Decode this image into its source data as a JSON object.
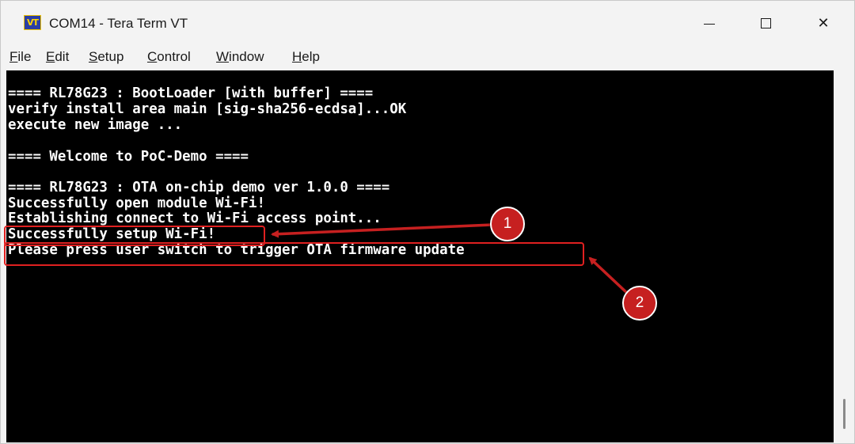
{
  "window": {
    "title": "COM14 - Tera Term VT",
    "icon_text": "VT",
    "controls": {
      "minimize": "minimize-icon",
      "maximize": "maximize-icon",
      "close": "close-icon",
      "close_glyph": "✕"
    }
  },
  "menu": {
    "items": [
      {
        "mnemonic": "F",
        "rest": "ile"
      },
      {
        "mnemonic": "E",
        "rest": "dit"
      },
      {
        "mnemonic": "S",
        "rest": "etup"
      },
      {
        "mnemonic": "C",
        "rest": "ontrol"
      },
      {
        "mnemonic": "W",
        "rest": "indow"
      },
      {
        "mnemonic": "H",
        "rest": "elp"
      }
    ]
  },
  "terminal": {
    "lines": [
      "==== RL78G23 : BootLoader [with buffer] ====",
      "verify install area main [sig-sha256-ecdsa]...OK",
      "execute new image ...",
      "",
      "==== Welcome to PoC-Demo ====",
      "",
      "==== RL78G23 : OTA on-chip demo ver 1.0.0 ====",
      "Successfully open module Wi-Fi!",
      "Establishing connect to Wi-Fi access point...",
      "Successfully setup Wi-Fi!",
      "Please press user switch to trigger OTA firmware update"
    ]
  },
  "annotations": {
    "callout_1": "1",
    "callout_2": "2",
    "color": "#c62020"
  }
}
